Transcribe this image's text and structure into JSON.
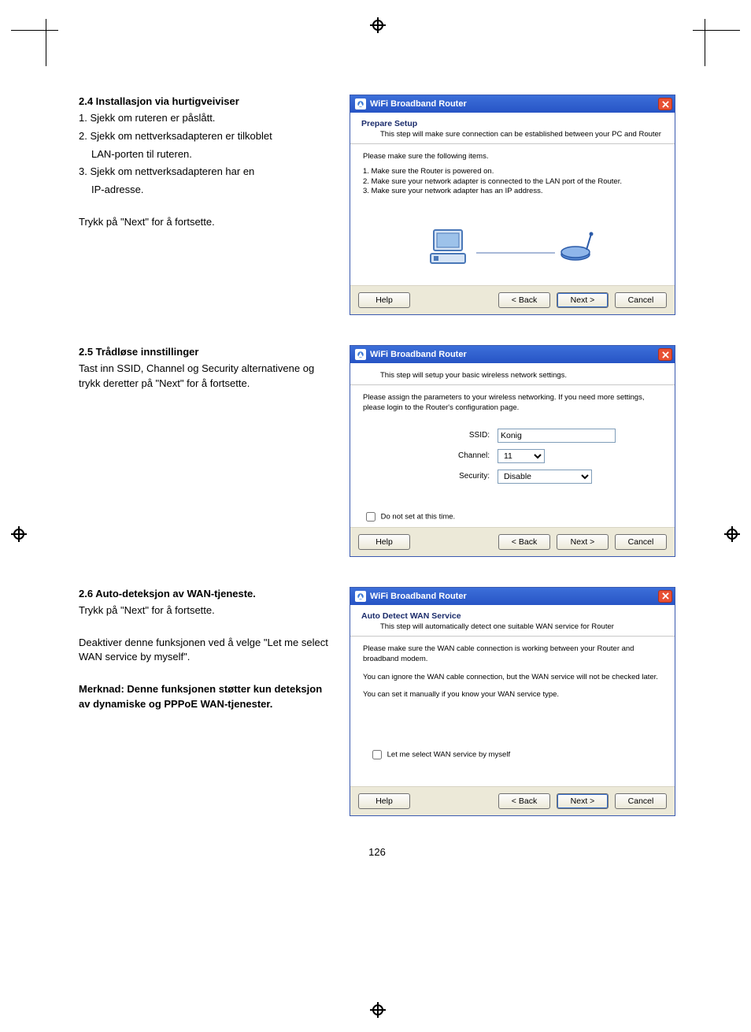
{
  "pageNumber": "126",
  "sections": [
    {
      "heading": "2.4 Installasjon via hurtigveiviser",
      "lines": [
        "1. Sjekk om ruteren er påslått.",
        "2. Sjekk om nettverksadapteren er tilkoblet",
        "    LAN-porten til ruteren.",
        "3. Sjekk om nettverksadapteren har en",
        "    IP-adresse."
      ],
      "after": "Trykk på \"Next\" for å fortsette."
    },
    {
      "heading": "2.5 Trådløse innstillinger",
      "body": "Tast inn SSID, Channel og Security alternativene og trykk deretter på \"Next\" for å fortsette."
    },
    {
      "heading": "2.6 Auto-deteksjon av WAN-tjeneste.",
      "body1": "Trykk på \"Next\" for å fortsette.",
      "body2": "Deaktiver denne funksjonen ved å velge \"Let me select WAN service by myself\".",
      "note": "Merknad: Denne funksjonen støtter kun deteksjon av dynamiske og PPPoE WAN-tjenester."
    }
  ],
  "dialog_title": "WiFi Broadband Router",
  "buttons": {
    "help": "Help",
    "back": "< Back",
    "next": "Next >",
    "cancel": "Cancel"
  },
  "dlg1": {
    "hdr_title": "Prepare Setup",
    "hdr_sub": "This step will make sure connection can be established between your PC and Router",
    "intro": "Please make sure the following items.",
    "items": [
      "1. Make sure the Router is powered on.",
      "2. Make sure your network adapter is connected to the LAN port of the Router.",
      "3. Make sure your network adapter has an IP address."
    ]
  },
  "dlg2": {
    "hdr_sub": "This step will setup your basic wireless network settings.",
    "intro": "Please assign the parameters to your wireless networking. If you need more settings, please login to the Router's configuration page.",
    "ssid_label": "SSID:",
    "ssid_value": "Konig",
    "channel_label": "Channel:",
    "channel_value": "11",
    "security_label": "Security:",
    "security_value": "Disable",
    "check_label": "Do not set at this time."
  },
  "dlg3": {
    "hdr_title": "Auto Detect WAN Service",
    "hdr_sub": "This step will automatically detect one suitable WAN service for Router",
    "p1": "Please make sure the WAN cable connection is working between your Router and broadband modem.",
    "p2": "You can ignore the WAN cable connection, but the WAN service will not be checked later.",
    "p3": "You can set it manually if you know your WAN service type.",
    "check_label": "Let me select WAN service by myself"
  }
}
